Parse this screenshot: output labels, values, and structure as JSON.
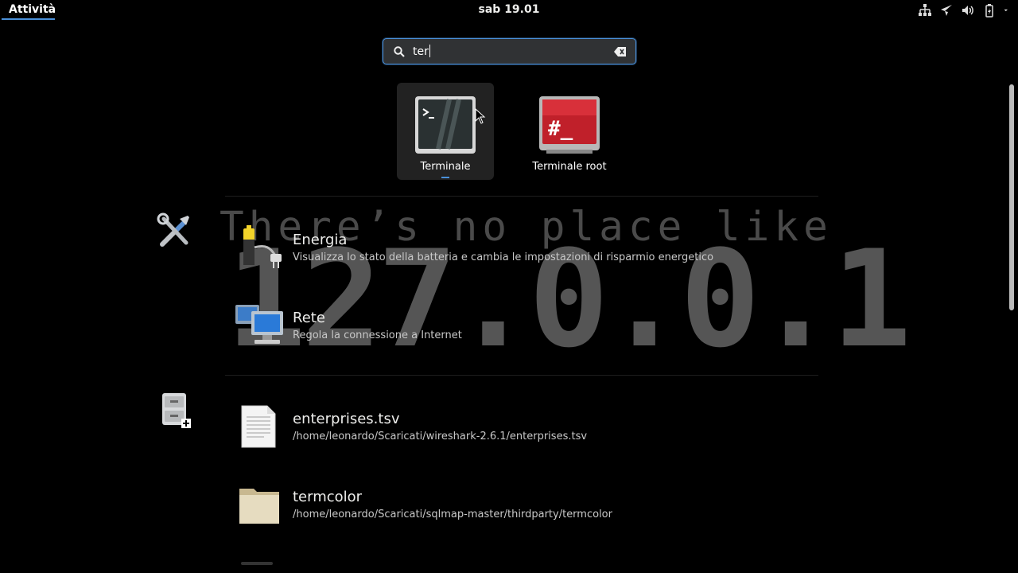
{
  "topbar": {
    "activities_label": "Attività",
    "clock": "sab 19.01",
    "tray_icons": [
      "network-icon",
      "airplane-mode-icon",
      "volume-icon",
      "battery-icon",
      "menu-arrow-icon"
    ]
  },
  "search": {
    "value": "ter",
    "icon": "search-icon",
    "clear_icon": "clear-icon"
  },
  "apps": [
    {
      "label": "Terminale",
      "icon": "terminal-icon",
      "selected": true
    },
    {
      "label": "Terminale root",
      "icon": "root-terminal-icon",
      "selected": false
    }
  ],
  "wallpaper": {
    "line1": "There’s no place like",
    "line2": "127.0.0.1"
  },
  "settings_results": [
    {
      "title": "Energia",
      "description": "Visualizza lo stato della batteria e cambia le impostazioni di risparmio energetico",
      "icon": "battery-power-icon"
    },
    {
      "title": "Rete",
      "description": "Regola la connessione a Internet",
      "icon": "network-computer-icon"
    }
  ],
  "file_results": [
    {
      "title": "enterprises.tsv",
      "path": "/home/leonardo/Scaricati/wireshark-2.6.1/enterprises.tsv",
      "icon": "text-file-icon"
    },
    {
      "title": "termcolor",
      "path": "/home/leonardo/Scaricati/sqlmap-master/thirdparty/termcolor",
      "icon": "folder-icon"
    }
  ],
  "providers": [
    "settings-provider-icon",
    "file-cabinet-provider-icon"
  ],
  "colors": {
    "accent": "#4a90d9",
    "background": "#000000"
  }
}
